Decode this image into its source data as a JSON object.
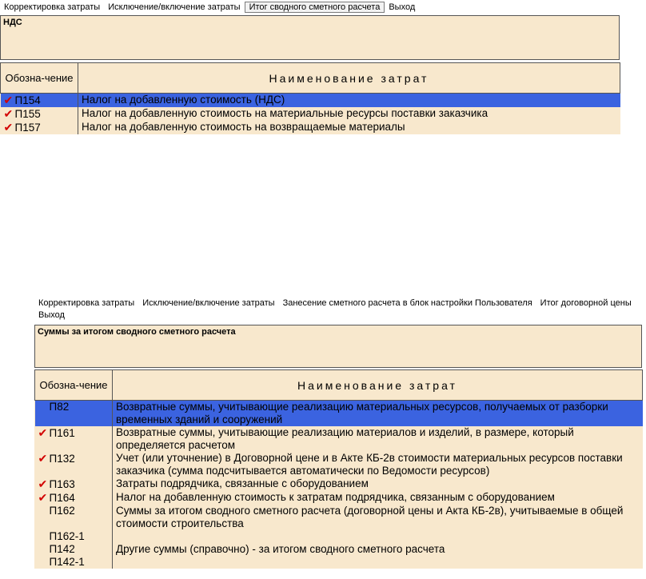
{
  "top": {
    "menu": [
      "Корректировка затраты",
      "Исключение/включение затраты",
      "Итог сводного сметного расчета",
      "Выход"
    ],
    "section_title": "НДС",
    "headers": {
      "code": "Обозна-чение",
      "name": "Наименование затрат"
    },
    "rows": [
      {
        "checked": true,
        "code": "П154",
        "name": "Налог на добавленную стоимость (НДС)",
        "selected": true
      },
      {
        "checked": true,
        "code": "П155",
        "name": "Налог на добавленную стоимость на материальные ресурсы поставки заказчика",
        "selected": false
      },
      {
        "checked": true,
        "code": "П157",
        "name": "Налог на добавленную стоимость на возвращаемые материалы",
        "selected": false
      }
    ]
  },
  "bottom": {
    "menu": [
      "Корректировка затраты",
      "Исключение/включение затраты",
      "Занесение сметного расчета в блок настройки Пользователя",
      "Итог договорной цены",
      "Выход"
    ],
    "section_title": "Суммы за итогом сводного сметного расчета",
    "headers": {
      "code": "Обозна-чение",
      "name": "Наименование затрат"
    },
    "rows": [
      {
        "checked": false,
        "code": "П82",
        "name": "Возвратные суммы, учитывающие реализацию материальных ресурсов, получаемых от разборки временных зданий и сооружений",
        "selected": true
      },
      {
        "checked": true,
        "code": "П161",
        "name": "Возвратные суммы, учитывающие реализацию материалов и изделий, в размере, который определяется расчетом",
        "selected": false
      },
      {
        "checked": true,
        "code": "П132",
        "name": "Учет (или уточнение) в Договорной цене и в Акте КБ-2в стоимости материальных ресурсов поставки заказчика (сумма подсчитывается автоматически по Ведомости ресурсов)",
        "selected": false
      },
      {
        "checked": true,
        "code": "П163",
        "name": "Затраты подрядчика, связанные с оборудованием",
        "selected": false
      },
      {
        "checked": true,
        "code": "П164",
        "name": "Налог на добавленную стоимость к затратам подрядчика, связанным с оборудованием",
        "selected": false
      },
      {
        "checked": false,
        "code": "П162",
        "name": "Суммы за итогом сводного сметного расчета (договорной цены и Акта КБ-2в), учитываемые в общей стоимости строительства",
        "selected": false
      },
      {
        "checked": false,
        "code": "П162-1",
        "name": "",
        "selected": false
      },
      {
        "checked": false,
        "code": "П142",
        "name": "Другие суммы (справочно) - за итогом сводного сметного расчета",
        "selected": false
      },
      {
        "checked": false,
        "code": "П142-1",
        "name": "",
        "selected": false
      }
    ]
  },
  "check_symbol": "✔"
}
